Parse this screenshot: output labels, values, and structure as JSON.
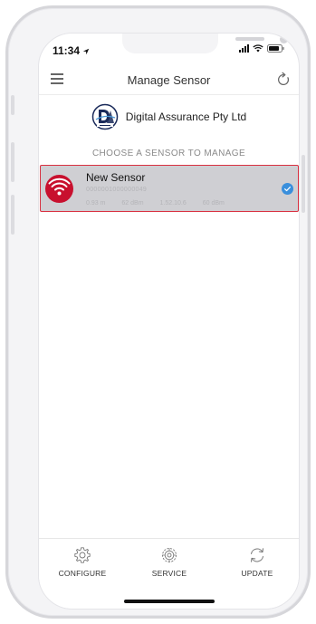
{
  "status_bar": {
    "time": "11:34",
    "location_icon": "location-arrow-icon",
    "signal_icon": "cellular-signal-icon",
    "wifi_icon": "wifi-icon",
    "battery_icon": "battery-icon"
  },
  "header": {
    "title": "Manage Sensor",
    "menu_icon": "hamburger-menu-icon",
    "refresh_icon": "refresh-icon"
  },
  "organization": {
    "name": "Digital Assurance Pty Ltd",
    "logo_icon": "da-logo-icon"
  },
  "section_label": "CHOOSE A SENSOR TO MANAGE",
  "sensors": [
    {
      "name": "New Sensor",
      "id": "0000001000000049",
      "stats": [
        "0.93 m",
        "62 dBm",
        "1.52.10.6",
        "60 dBm"
      ],
      "icon": "wifi-sensor-icon",
      "selected": true
    }
  ],
  "tabs": [
    {
      "label": "CONFIGURE",
      "icon": "gear-icon"
    },
    {
      "label": "SERVICE",
      "icon": "service-cog-icon"
    },
    {
      "label": "UPDATE",
      "icon": "sync-icon"
    }
  ],
  "colors": {
    "accent_red": "#c8102e",
    "selection_border": "#d93040",
    "check_blue": "#3a8fdc",
    "card_bg": "#cfcfd3"
  }
}
